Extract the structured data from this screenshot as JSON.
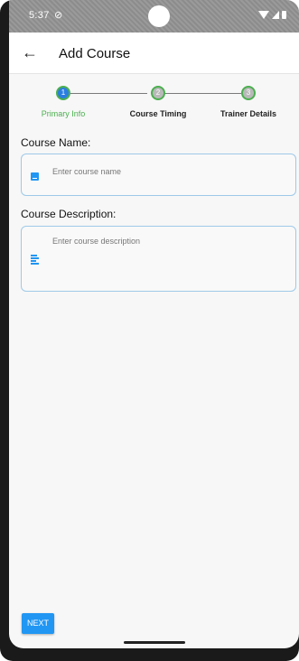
{
  "status_bar": {
    "time": "5:37",
    "dnd_icon": "do-not-disturb-icon",
    "wifi_icon": "wifi-icon",
    "signal_icon": "signal-icon",
    "battery_icon": "battery-icon"
  },
  "app_bar": {
    "back_icon": "arrow-left-icon",
    "title": "Add Course"
  },
  "stepper": {
    "steps": [
      {
        "number": "1",
        "label": "Primary Info",
        "active": true
      },
      {
        "number": "2",
        "label": "Course Timing",
        "active": false
      },
      {
        "number": "3",
        "label": "Trainer Details",
        "active": false
      }
    ]
  },
  "form": {
    "course_name": {
      "label": "Course Name:",
      "placeholder": "Enter course name",
      "icon": "book-icon"
    },
    "course_description": {
      "label": "Course Description:",
      "placeholder": "Enter course description",
      "icon": "notes-icon"
    }
  },
  "actions": {
    "next_label": "NEXT"
  },
  "colors": {
    "accent": "#2196f3",
    "step_active": "#4caf50",
    "field_border": "#9ec9e8"
  }
}
